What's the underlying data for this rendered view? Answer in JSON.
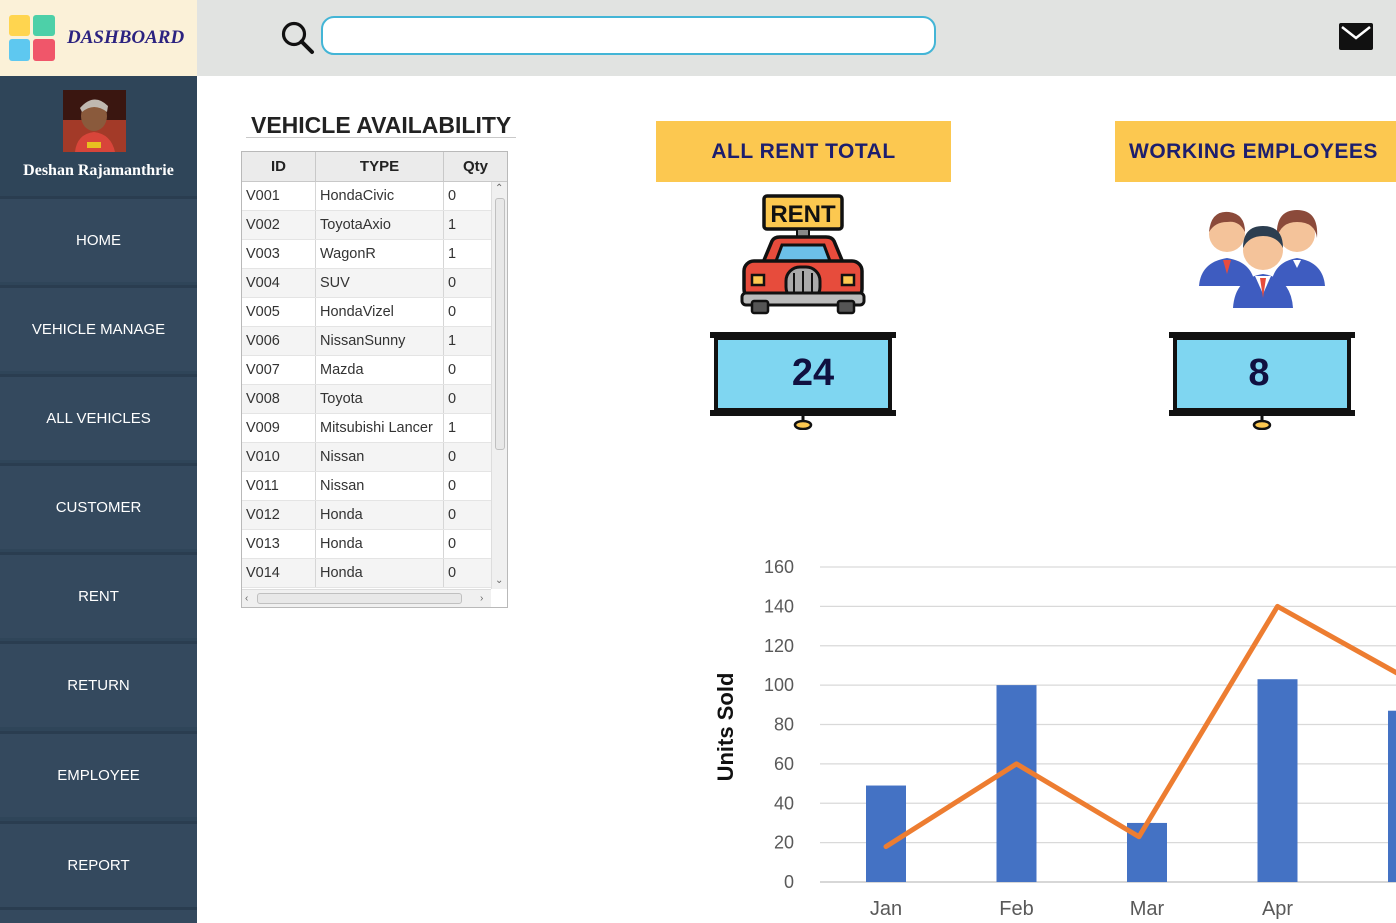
{
  "brand": {
    "title": "DASHBOARD"
  },
  "profile": {
    "name": "Deshan Rajamanthrie"
  },
  "sidebar": {
    "items": [
      {
        "label": "HOME"
      },
      {
        "label": "VEHICLE MANAGE"
      },
      {
        "label": "ALL VEHICLES"
      },
      {
        "label": "CUSTOMER"
      },
      {
        "label": "RENT"
      },
      {
        "label": "RETURN"
      },
      {
        "label": "EMPLOYEE"
      },
      {
        "label": "REPORT"
      }
    ]
  },
  "search": {
    "value": "",
    "placeholder": ""
  },
  "vehicles": {
    "title": "VEHICLE AVAILABILITY",
    "columns": [
      "ID",
      "TYPE",
      "Qty"
    ],
    "rows": [
      [
        "V001",
        "HondaCivic",
        "0"
      ],
      [
        "V002",
        "ToyotaAxio",
        "1"
      ],
      [
        "V003",
        "WagonR",
        "1"
      ],
      [
        "V004",
        "SUV",
        "0"
      ],
      [
        "V005",
        "HondaVizel",
        "0"
      ],
      [
        "V006",
        "NissanSunny",
        "1"
      ],
      [
        "V007",
        "Mazda",
        "0"
      ],
      [
        "V008",
        "Toyota",
        "0"
      ],
      [
        "V009",
        "Mitsubishi Lancer",
        "1"
      ],
      [
        "V010",
        "Nissan",
        "0"
      ],
      [
        "V011",
        "Nissan",
        "0"
      ],
      [
        "V012",
        "Honda",
        "0"
      ],
      [
        "V013",
        "Honda",
        "0"
      ],
      [
        "V014",
        "Honda",
        "0"
      ]
    ]
  },
  "cards": {
    "rent": {
      "label": "ALL RENT TOTAL",
      "sign": "RENT",
      "value": "24"
    },
    "employees": {
      "label": "WORKING EMPLOYEES",
      "value": "8"
    }
  },
  "colors": {
    "sidebar": "#34495e",
    "card": "#fcc850",
    "board": "#7fd6f1",
    "bar": "#4472c4",
    "line": "#ed7d31"
  },
  "chart_data": {
    "type": "bar",
    "categories": [
      "Jan",
      "Feb",
      "Mar",
      "Apr",
      "M"
    ],
    "series": [
      {
        "type": "bar",
        "values": [
          49,
          100,
          30,
          103,
          87
        ]
      },
      {
        "type": "line",
        "values": [
          18,
          60,
          23,
          140,
          103
        ]
      }
    ],
    "xlabel": "",
    "ylabel": "Units Sold",
    "ylim": [
      0,
      160
    ],
    "yticks": [
      "0",
      "20",
      "40",
      "60",
      "80",
      "100",
      "120",
      "140",
      "160"
    ],
    "grid": true
  }
}
